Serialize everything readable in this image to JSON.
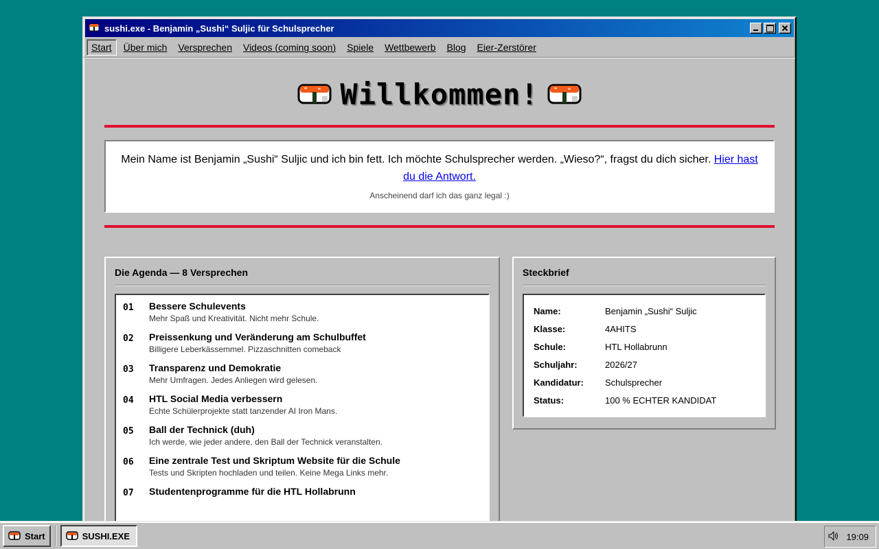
{
  "window": {
    "title": "sushi.exe - Benjamin „Sushi“ Suljic für Schulsprecher"
  },
  "menu": [
    {
      "label": "Start",
      "active": true
    },
    {
      "label": "Über mich"
    },
    {
      "label": "Versprechen"
    },
    {
      "label": "Videos (coming soon)"
    },
    {
      "label": "Spiele"
    },
    {
      "label": "Wettbewerb"
    },
    {
      "label": "Blog"
    },
    {
      "label": "Eier-Zerstörer"
    }
  ],
  "hero": {
    "heading": "Willkommen!",
    "icon": "sushi-icon"
  },
  "intro": {
    "text": "Mein Name ist Benjamin „Sushi“ Suljic und ich bin fett. Ich möchte Schulsprecher werden. „Wieso?“, fragst du dich sicher. ",
    "link": "Hier hast du die Antwort.",
    "note": "Anscheinend darf ich das ganz legal :)"
  },
  "agenda": {
    "title": "Die Agenda — 8 Versprechen",
    "items": [
      {
        "num": "01",
        "title": "Bessere Schulevents",
        "desc": "Mehr Spaß und Kreativität. Nicht mehr Schule."
      },
      {
        "num": "02",
        "title": "Preissenkung und Veränderung am Schulbuffet",
        "desc": "Billigere Leberkässemmel. Pizzaschnitten comeback"
      },
      {
        "num": "03",
        "title": "Transparenz und Demokratie",
        "desc": "Mehr Umfragen. Jedes Anliegen wird gelesen."
      },
      {
        "num": "04",
        "title": "HTL Social Media verbessern",
        "desc": "Echte Schülerprojekte statt tanzender AI Iron Mans."
      },
      {
        "num": "05",
        "title": "Ball der Technick (duh)",
        "desc": "Ich werde, wie jeder andere, den Ball der Technick veranstalten."
      },
      {
        "num": "06",
        "title": "Eine zentrale Test und Skriptum Website für die Schule",
        "desc": "Tests und Skripten hochladen und teilen. Keine Mega Links mehr."
      },
      {
        "num": "07",
        "title": "Studentenprogramme für die HTL Hollabrunn",
        "desc": ""
      }
    ]
  },
  "profile": {
    "title": "Steckbrief",
    "rows": [
      {
        "key": "Name:",
        "value": "Benjamin „Sushi“ Suljic"
      },
      {
        "key": "Klasse:",
        "value": "4AHITS"
      },
      {
        "key": "Schule:",
        "value": "HTL Hollabrunn"
      },
      {
        "key": "Schuljahr:",
        "value": "2026/27"
      },
      {
        "key": "Kandidatur:",
        "value": "Schulsprecher"
      },
      {
        "key": "Status:",
        "value": "100 % ECHTER KANDIDAT"
      }
    ]
  },
  "taskbar": {
    "start": "Start",
    "task": "SUSHI.EXE",
    "time": "19:09"
  },
  "colors": {
    "desktop": "#008080",
    "accent_rule": "#e01030",
    "title_bar": "#000080"
  }
}
